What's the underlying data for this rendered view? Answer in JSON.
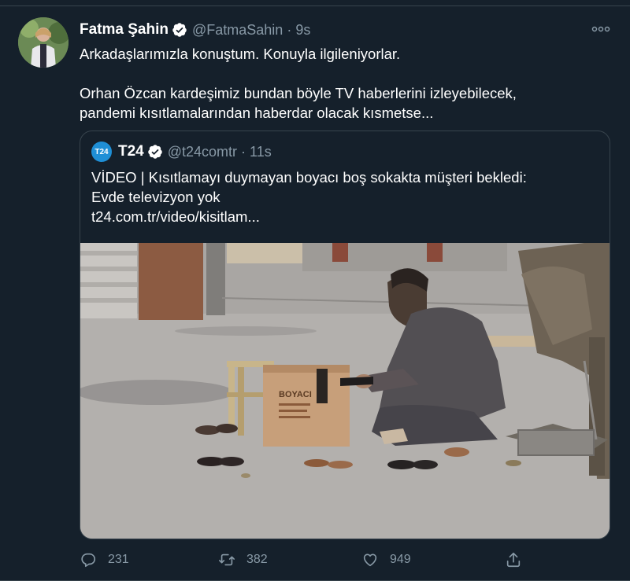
{
  "tweet": {
    "author_name": "Fatma Şahin",
    "author_handle": "@FatmaSahin",
    "separator": "·",
    "time": "9s",
    "text_lines": [
      "Arkadaşlarımızla konuştum. Konuyla ilgileniyorlar.",
      "Orhan Özcan kardeşimiz bundan böyle TV haberlerini izleyebilecek,",
      "pandemi kısıtlamalarından haberdar olacak kısmetse..."
    ]
  },
  "quote": {
    "logo_text": "T24",
    "author_name": "T24",
    "author_handle": "@t24comtr",
    "separator": "·",
    "time": "11s",
    "text_lines": [
      "VİDEO | Kısıtlamayı duymayan boyacı boş sokakta müşteri bekledi:",
      "Evde televizyon yok",
      "t24.com.tr/video/kisitlam..."
    ],
    "media_box_text": "BOYACI"
  },
  "actions": {
    "reply_count": "231",
    "retweet_count": "382",
    "like_count": "949"
  },
  "colors": {
    "background": "#15202b",
    "secondary_text": "#8899a6",
    "border": "#38444d",
    "accent": "#1da1f2"
  },
  "icons": {
    "verified": "verified-badge-icon",
    "more": "more-options-icon",
    "reply": "reply-icon",
    "retweet": "retweet-icon",
    "like": "like-icon",
    "share": "share-icon"
  }
}
